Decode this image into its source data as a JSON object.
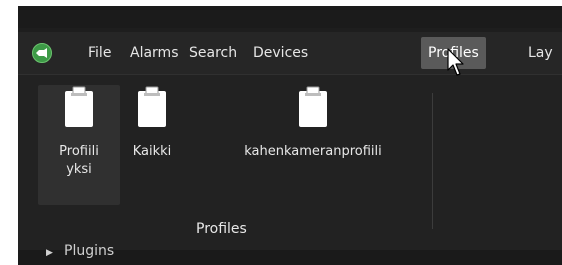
{
  "menubar": {
    "logo_icon": "app-logo-icon",
    "items": [
      {
        "label": "File"
      },
      {
        "label": "Alarms"
      },
      {
        "label": "Search"
      },
      {
        "label": "Devices"
      },
      {
        "label": "Profiles"
      },
      {
        "label": "Lay"
      }
    ],
    "active_index": 4
  },
  "ribbon": {
    "profiles": [
      {
        "label_line1": "Profiili",
        "label_line2": "yksi",
        "icon": "clipboard-icon",
        "selected": true
      },
      {
        "label_line1": "Kaikki",
        "label_line2": "",
        "icon": "clipboard-icon",
        "selected": false
      },
      {
        "label_line1": "kahenkameranprofiili",
        "label_line2": "",
        "icon": "clipboard-icon",
        "selected": false
      }
    ],
    "group_label": "Profiles"
  },
  "tree": {
    "plugins_label": "Plugins",
    "plugins_icon": "expand-arrow-icon"
  },
  "colors": {
    "background": "#1e1e1e",
    "menu_active": "#5a5a5a",
    "logo_green": "#3d9a47",
    "text": "#e8e8e8"
  }
}
